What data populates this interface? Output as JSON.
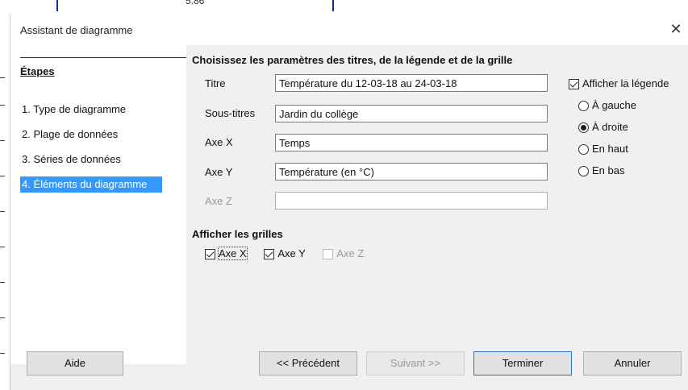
{
  "background": {
    "cell_value": "5.86"
  },
  "dialog": {
    "title": "Assistant de diagramme",
    "close_glyph": "✕"
  },
  "sidebar": {
    "heading": "Étapes",
    "steps": [
      {
        "label": "1. Type de diagramme"
      },
      {
        "label": "2. Plage de données"
      },
      {
        "label": "3. Séries de données"
      },
      {
        "label": "4. Éléments du diagramme"
      }
    ]
  },
  "main": {
    "section_title": "Choisissez les paramètres des titres, de la légende et de la grille",
    "fields": {
      "titre": {
        "label": "Titre",
        "value": "Température du 12-03-18 au 24-03-18"
      },
      "sous_titres": {
        "label": "Sous-titres",
        "value": "Jardin du collège"
      },
      "axe_x": {
        "label": "Axe X",
        "value": "Temps"
      },
      "axe_y": {
        "label": "Axe Y",
        "value": "Température (en °C)"
      },
      "axe_z": {
        "label": "Axe Z",
        "value": ""
      }
    },
    "legend": {
      "show_label": "Afficher la légende",
      "options": [
        {
          "label": "À gauche"
        },
        {
          "label": "À droite"
        },
        {
          "label": "En haut"
        },
        {
          "label": "En bas"
        }
      ]
    },
    "grids": {
      "title": "Afficher les grilles",
      "axe_x": "Axe X",
      "axe_y": "Axe Y",
      "axe_z": "Axe Z"
    }
  },
  "buttons": {
    "help": "Aide",
    "previous": "<< Précédent",
    "next": "Suivant >>",
    "finish": "Terminer",
    "cancel": "Annuler"
  }
}
